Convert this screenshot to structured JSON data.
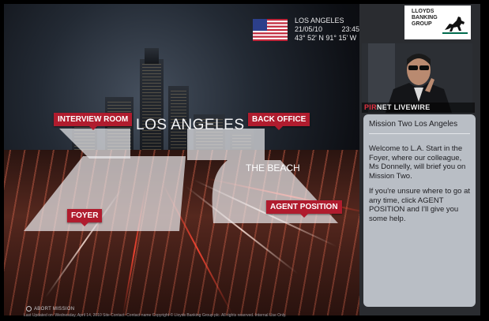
{
  "location": {
    "city": "LOS ANGELES",
    "date": "21/05/10",
    "time": "23:45",
    "coordinates": "43° 52' N 91° 15' W",
    "flag_icon": "usa-flag-icon"
  },
  "map": {
    "city_label": "LOS ANGELES",
    "zone_label": "THE BEACH",
    "pins": [
      {
        "label": "INTERVIEW ROOM"
      },
      {
        "label": "BACK OFFICE"
      },
      {
        "label": "FOYER"
      },
      {
        "label": "AGENT POSITION"
      }
    ]
  },
  "abort_label": "ABORT MISSION",
  "footer_text": "Last Updated on: Wednesday, April 14, 2010   Site Contact: Contact name   Copyright © Lloyds Banking Group plc. All rights reserved. Internal Use Only.",
  "brand": {
    "line1": "LLOYDS",
    "line2": "BANKING",
    "line3": "GROUP",
    "logo_icon": "black-horse-icon"
  },
  "livewire": {
    "accent": "PIR",
    "rest": "NET LIVEWIRE"
  },
  "message": {
    "title": "Mission Two Los Angeles",
    "paragraph1": "Welcome to L.A. Start in the Foyer, where our colleague, Ms Donnelly, will brief you on Mission Two.",
    "paragraph2": "If you're unsure where to go at any time, click AGENT POSITION and I'll give you some help."
  },
  "colors": {
    "pin_red": "#b01c2e",
    "panel_bg": "#2a2c30",
    "message_bg": "#b9bec5",
    "brand_green": "#006a4d"
  }
}
